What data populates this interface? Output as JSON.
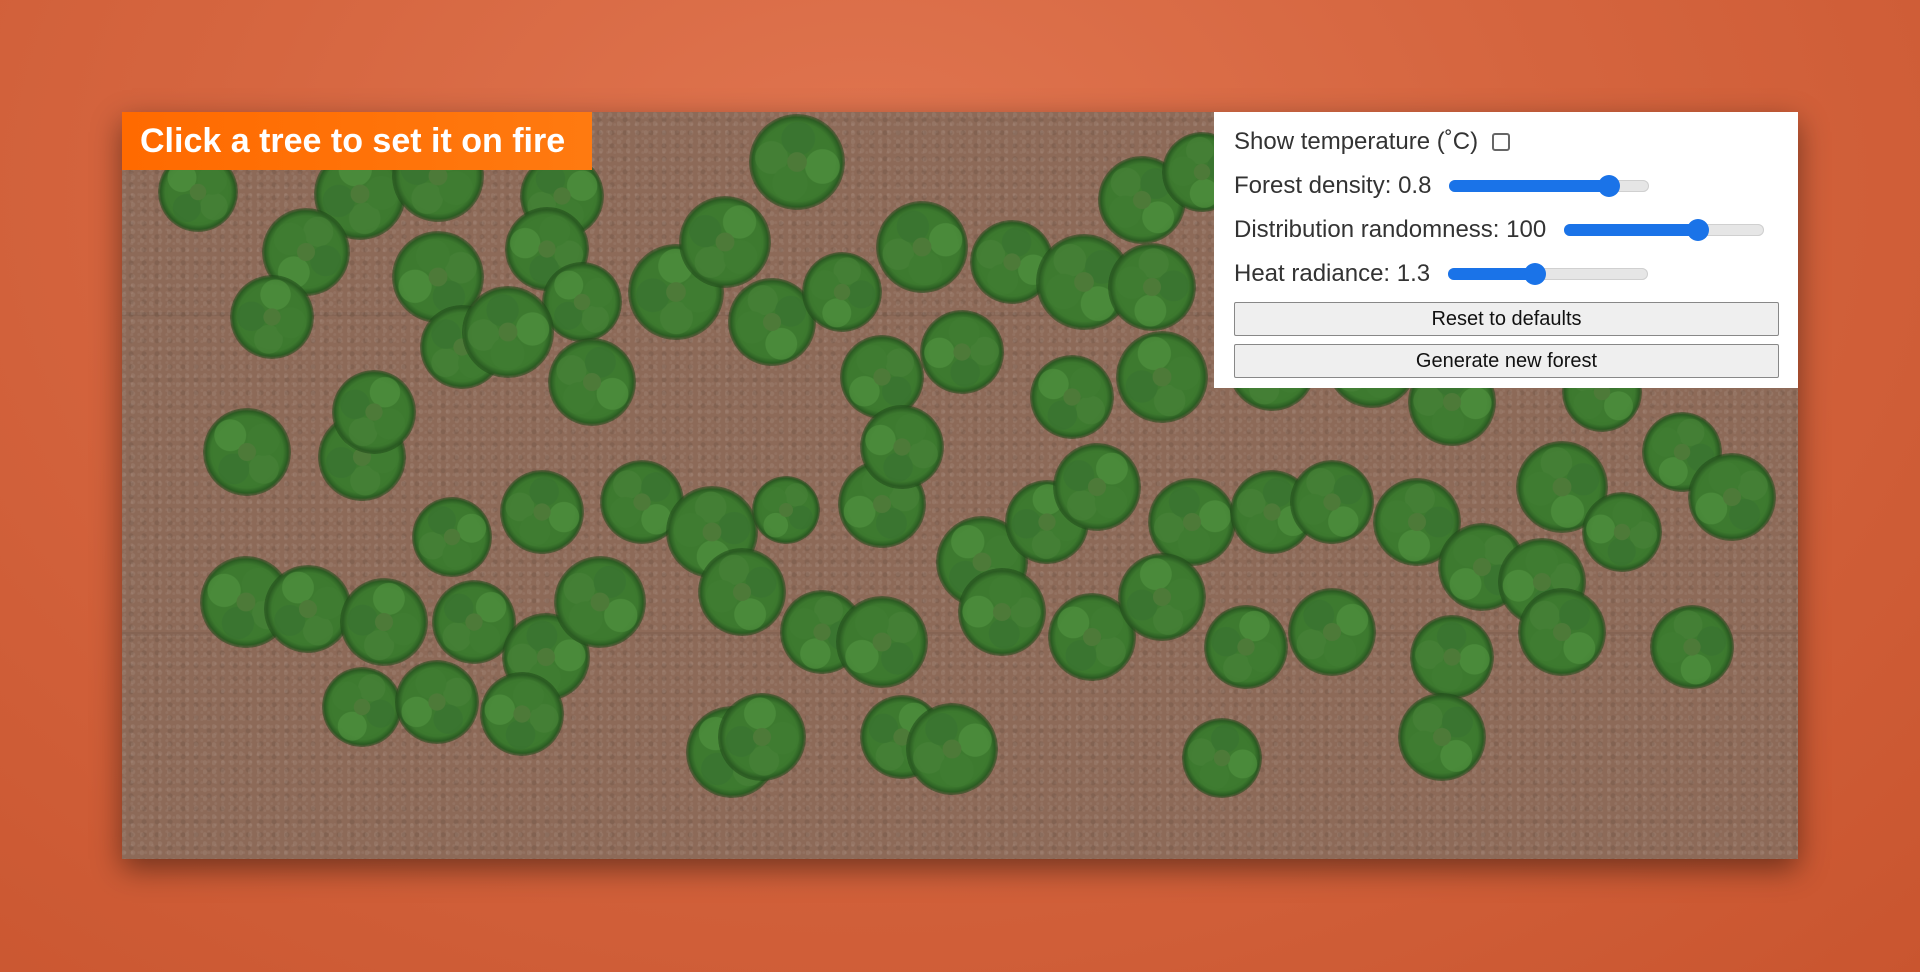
{
  "banner": {
    "text": "Click a tree to set it on fire"
  },
  "controls": {
    "temperature": {
      "label": "Show temperature (˚C)",
      "checked": false
    },
    "density": {
      "label": "Forest density: 0.8",
      "value": 0.8,
      "min": 0,
      "max": 1
    },
    "randomness": {
      "label": "Distribution randomness: 100",
      "value": 100,
      "min": 0,
      "max": 150
    },
    "heat": {
      "label": "Heat radiance: 1.3",
      "value": 1.3,
      "min": 0,
      "max": 3
    },
    "reset_label": "Reset to defaults",
    "generate_label": "Generate new forest"
  },
  "colors": {
    "accent": "#1a73e8",
    "banner": "#ff6a00",
    "ground": "#8d6a58",
    "tree": "#3d7a2f"
  }
}
